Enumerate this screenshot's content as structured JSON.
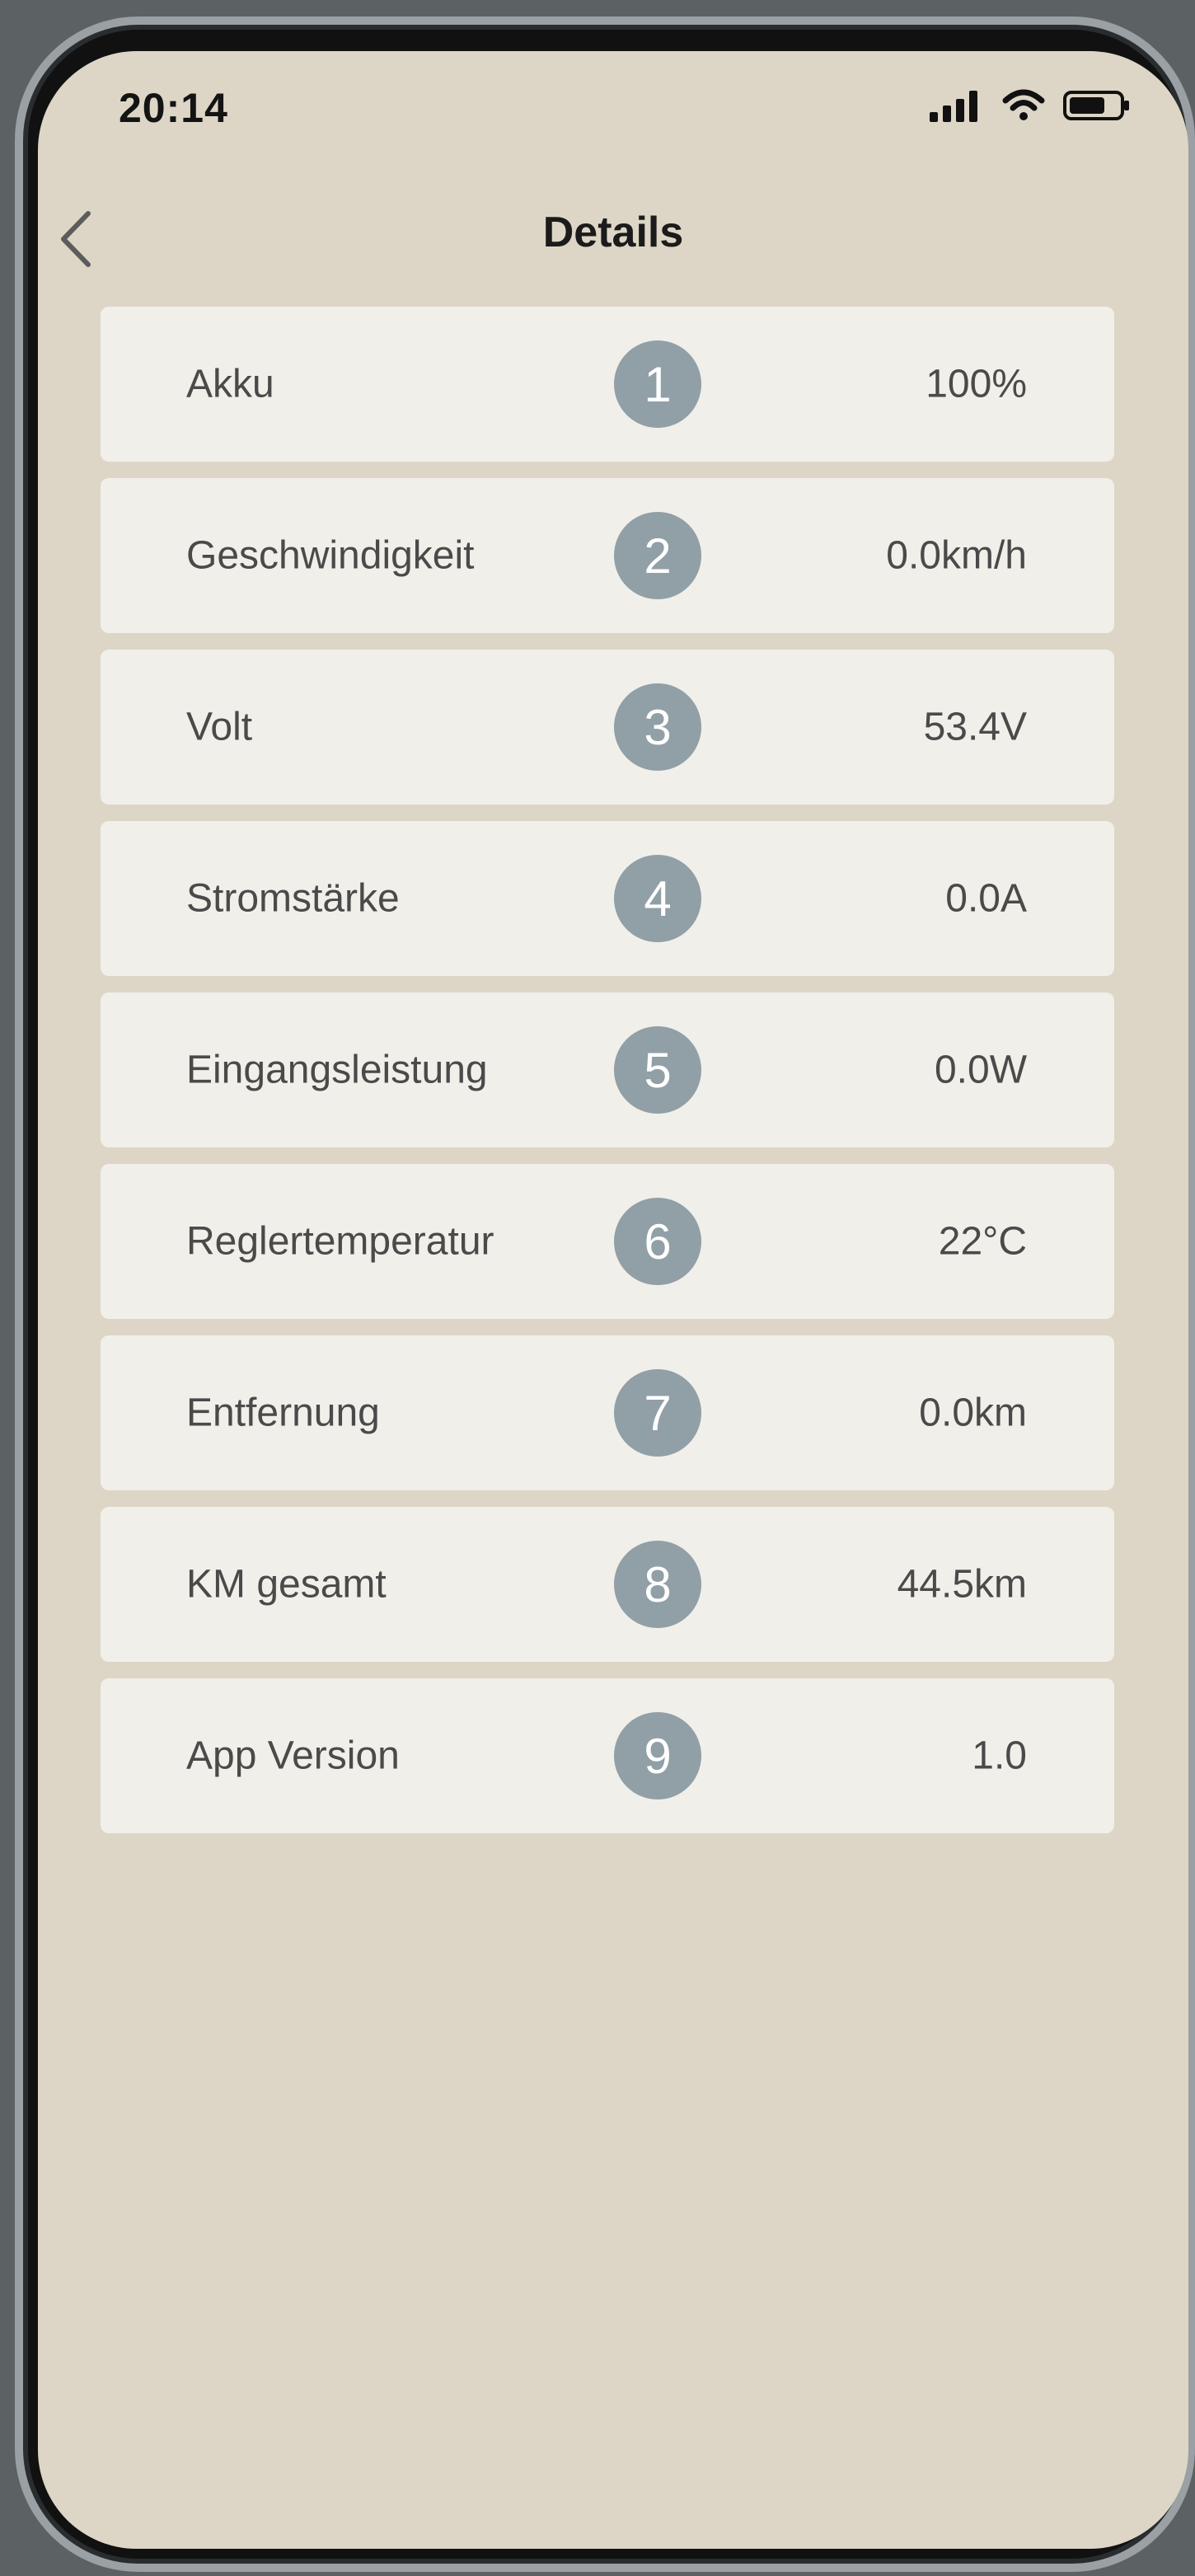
{
  "status_bar": {
    "time": "20:14",
    "icons": [
      "signal-icon",
      "wifi-icon",
      "battery-icon"
    ]
  },
  "header": {
    "title": "Details",
    "back_icon": "chevron-left-icon"
  },
  "details": [
    {
      "label": "Akku",
      "badge": "1",
      "value": "100%"
    },
    {
      "label": "Geschwindigkeit",
      "badge": "2",
      "value": "0.0km/h"
    },
    {
      "label": "Volt",
      "badge": "3",
      "value": "53.4V"
    },
    {
      "label": "Stromstärke",
      "badge": "4",
      "value": "0.0A"
    },
    {
      "label": "Eingangsleistung",
      "badge": "5",
      "value": "0.0W"
    },
    {
      "label": "Reglertemperatur",
      "badge": "6",
      "value": "22°C"
    },
    {
      "label": "Entfernung",
      "badge": "7",
      "value": "0.0km"
    },
    {
      "label": "KM gesamt",
      "badge": "8",
      "value": "44.5km"
    },
    {
      "label": "App Version",
      "badge": "9",
      "value": "1.0"
    }
  ],
  "colors": {
    "background": "#ddd6c6",
    "row_background": "#f1efe9",
    "badge": "#919fa7",
    "text": "#4a4a4a"
  }
}
